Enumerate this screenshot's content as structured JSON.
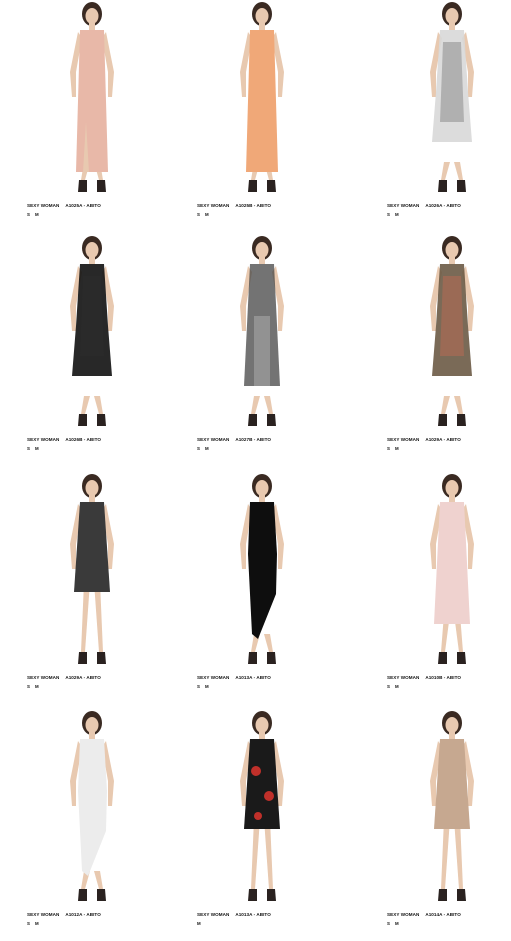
{
  "colors": {
    "skin": "#e8c9b0",
    "hair": "#3a2a22",
    "shoe": "#2a2220"
  },
  "products": [
    {
      "brand": "SEXY WOMAN",
      "code": "A1025A",
      "type": "ABITO",
      "sizes": [
        "S",
        "M"
      ],
      "dress_color": "#e8b8a8",
      "style": "maxi-slit"
    },
    {
      "brand": "SEXY WOMAN",
      "code": "A1025B",
      "type": "ABITO",
      "sizes": [
        "S",
        "M"
      ],
      "dress_color": "#f0a878",
      "style": "maxi"
    },
    {
      "brand": "SEXY WOMAN",
      "code": "A1026A",
      "type": "ABITO",
      "sizes": [
        "S",
        "M"
      ],
      "dress_color": "#d8d8d8",
      "accent": "#b0b0b0",
      "style": "layered"
    },
    {
      "brand": "SEXY WOMAN",
      "code": "A1026B",
      "type": "ABITO",
      "sizes": [
        "S",
        "M"
      ],
      "dress_color": "#111111",
      "accent": "#2a2a2a",
      "style": "layered"
    },
    {
      "brand": "SEXY WOMAN",
      "code": "A1027B",
      "type": "ABITO",
      "sizes": [
        "S",
        "M"
      ],
      "dress_color": "#444444",
      "accent": "#9a9a9a",
      "style": "sheer"
    },
    {
      "brand": "SEXY WOMAN",
      "code": "A1029A",
      "type": "ABITO",
      "sizes": [
        "S",
        "M"
      ],
      "dress_color": "#6b5a45",
      "accent": "#9b6a55",
      "style": "layered"
    },
    {
      "brand": "SEXY WOMAN",
      "code": "A1029A",
      "type": "ABITO",
      "sizes": [
        "S",
        "M"
      ],
      "dress_color": "#3a3a3a",
      "style": "short"
    },
    {
      "brand": "SEXY WOMAN",
      "code": "A1013A",
      "type": "ABITO",
      "sizes": [
        "S",
        "M"
      ],
      "dress_color": "#0e0e0e",
      "style": "asym"
    },
    {
      "brand": "SEXY WOMAN",
      "code": "A1010B",
      "type": "ABITO",
      "sizes": [
        "S",
        "M"
      ],
      "dress_color": "#efd2cf",
      "style": "midi"
    },
    {
      "brand": "SEXY WOMAN",
      "code": "A1012A",
      "type": "ABITO",
      "sizes": [
        "S",
        "M"
      ],
      "dress_color": "#ececec",
      "style": "asym"
    },
    {
      "brand": "SEXY WOMAN",
      "code": "A1013A",
      "type": "ABITO",
      "sizes": [
        "M"
      ],
      "dress_color": "#1a1a1a",
      "accent": "#c0302a",
      "style": "short"
    },
    {
      "brand": "SEXY WOMAN",
      "code": "A1014A",
      "type": "ABITO",
      "sizes": [
        "S",
        "M"
      ],
      "dress_color": "#c6a890",
      "style": "short"
    }
  ]
}
